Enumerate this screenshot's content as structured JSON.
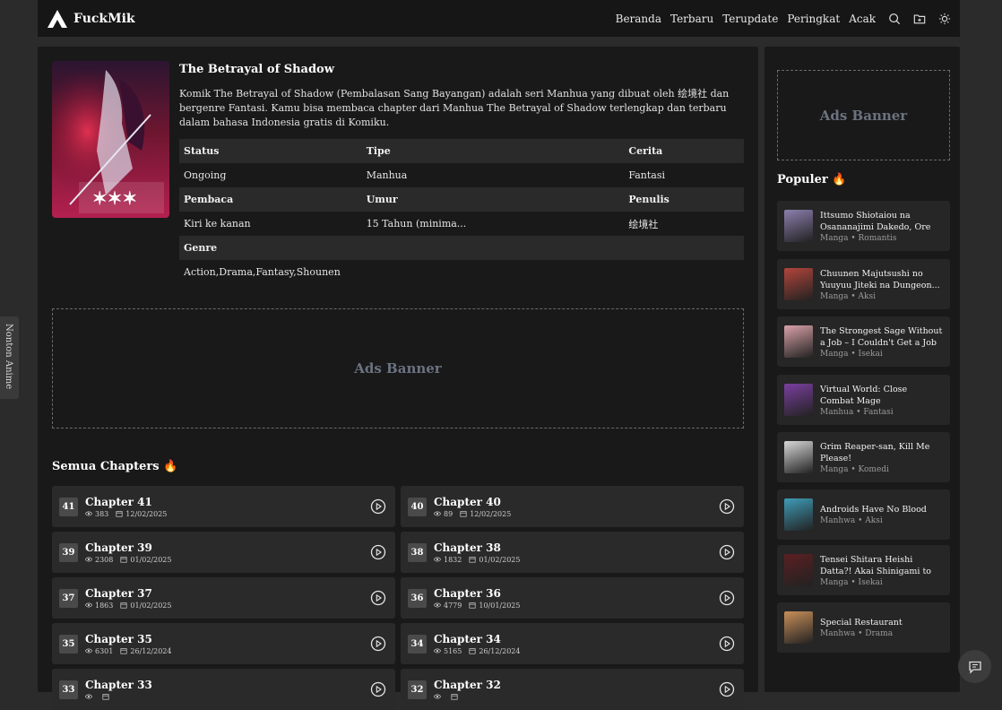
{
  "header": {
    "logo": "FuckMik",
    "nav": [
      "Beranda",
      "Terbaru",
      "Terupdate",
      "Peringkat",
      "Acak"
    ],
    "icons": [
      "search-icon",
      "folder-icon",
      "sun-icon"
    ]
  },
  "comic": {
    "title": "The Betrayal of Shadow",
    "description": "Komik The Betrayal of Shadow (Pembalasan Sang Bayangan) adalah seri Manhua yang dibuat oleh 绘境社 dan bergenre Fantasi. Kamu bisa membaca chapter dari Manhua The Betrayal of Shadow terlengkap dan terbaru dalam bahasa Indonesia gratis di Komiku.",
    "meta": {
      "status_label": "Status",
      "status": "Ongoing",
      "tipe_label": "Tipe",
      "tipe": "Manhua",
      "cerita_label": "Cerita",
      "cerita": "Fantasi",
      "pembaca_label": "Pembaca",
      "pembaca": "Kiri ke kanan",
      "umur_label": "Umur",
      "umur": "15 Tahun (minima...",
      "penulis_label": "Penulis",
      "penulis": "绘境社",
      "genre_label": "Genre",
      "genre": "Action,Drama,Fantasy,Shounen"
    }
  },
  "ads": {
    "label": "Ads Banner"
  },
  "chapters_title": "Semua Chapters 🔥",
  "chapters": [
    {
      "num": "41",
      "name": "Chapter 41",
      "views": "383",
      "date": "12/02/2025"
    },
    {
      "num": "40",
      "name": "Chapter 40",
      "views": "89",
      "date": "12/02/2025"
    },
    {
      "num": "39",
      "name": "Chapter 39",
      "views": "2308",
      "date": "01/02/2025"
    },
    {
      "num": "38",
      "name": "Chapter 38",
      "views": "1832",
      "date": "01/02/2025"
    },
    {
      "num": "37",
      "name": "Chapter 37",
      "views": "1863",
      "date": "01/02/2025"
    },
    {
      "num": "36",
      "name": "Chapter 36",
      "views": "4779",
      "date": "10/01/2025"
    },
    {
      "num": "35",
      "name": "Chapter 35",
      "views": "6301",
      "date": "26/12/2024"
    },
    {
      "num": "34",
      "name": "Chapter 34",
      "views": "5165",
      "date": "26/12/2024"
    },
    {
      "num": "33",
      "name": "Chapter 33",
      "views": "",
      "date": ""
    },
    {
      "num": "32",
      "name": "Chapter 32",
      "views": "",
      "date": ""
    }
  ],
  "popular_title": "Populer 🔥",
  "popular": [
    {
      "name": "Ittsumo Shiotaiou na Osananajimi Dakedo, Ore ni...",
      "sub": "Manga • Romantis",
      "color": "#8c7fae"
    },
    {
      "name": "Chuunen Majutsushi no Yuuyuu Jiteki na Dungeon...",
      "sub": "Manga • Aksi",
      "color": "#b3453b"
    },
    {
      "name": "The Strongest Sage Without a Job – I Couldn't Get a Job and...",
      "sub": "Manga • Isekai",
      "color": "#d9a2a8"
    },
    {
      "name": "Virtual World: Close Combat Mage",
      "sub": "Manhua • Fantasi",
      "color": "#7b3fa0"
    },
    {
      "name": "Grim Reaper-san, Kill Me Please!",
      "sub": "Manga • Komedi",
      "color": "#d8d8d8"
    },
    {
      "name": "Androids Have No Blood",
      "sub": "Manhwa • Aksi",
      "color": "#3f9cb8"
    },
    {
      "name": "Tensei Shitara Heishi Datta?! Akai Shinigami to Yobareta...",
      "sub": "Manga • Isekai",
      "color": "#5b1f22"
    },
    {
      "name": "Special Restaurant",
      "sub": "Manhwa • Drama",
      "color": "#c98f59"
    }
  ],
  "side_tab": "Nonton Anime"
}
